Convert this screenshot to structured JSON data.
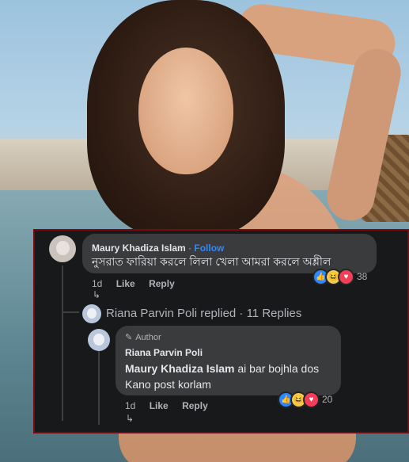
{
  "comment": {
    "author": "Maury Khadiza Islam",
    "separator": " · ",
    "follow": "Follow",
    "text": "নুসরাত ফারিয়া করলে লিলা খেলা আমরা করলে অশ্লীল",
    "time": "1d",
    "like": "Like",
    "reply": "Reply",
    "reaction_count": "38",
    "reactions": [
      "like-icon",
      "haha-icon",
      "love-icon"
    ]
  },
  "replies_summary": {
    "text": "Riana Parvin Poli replied · 11 Replies"
  },
  "reply": {
    "badge": "Author",
    "author": "Riana Parvin Poli",
    "mention": "Maury Khadiza Islam",
    "text_line1": " ai bar bojhla dos",
    "text_line2": "Kano post korlam",
    "time": "1d",
    "like": "Like",
    "reply": "Reply",
    "reaction_count": "20",
    "reactions": [
      "like-icon",
      "haha-icon",
      "love-icon"
    ]
  },
  "colors": {
    "panel_bg": "#18191a",
    "bubble_bg": "#3a3b3c",
    "accent_blue": "#2d88ff",
    "border_red": "#7a0a12"
  }
}
